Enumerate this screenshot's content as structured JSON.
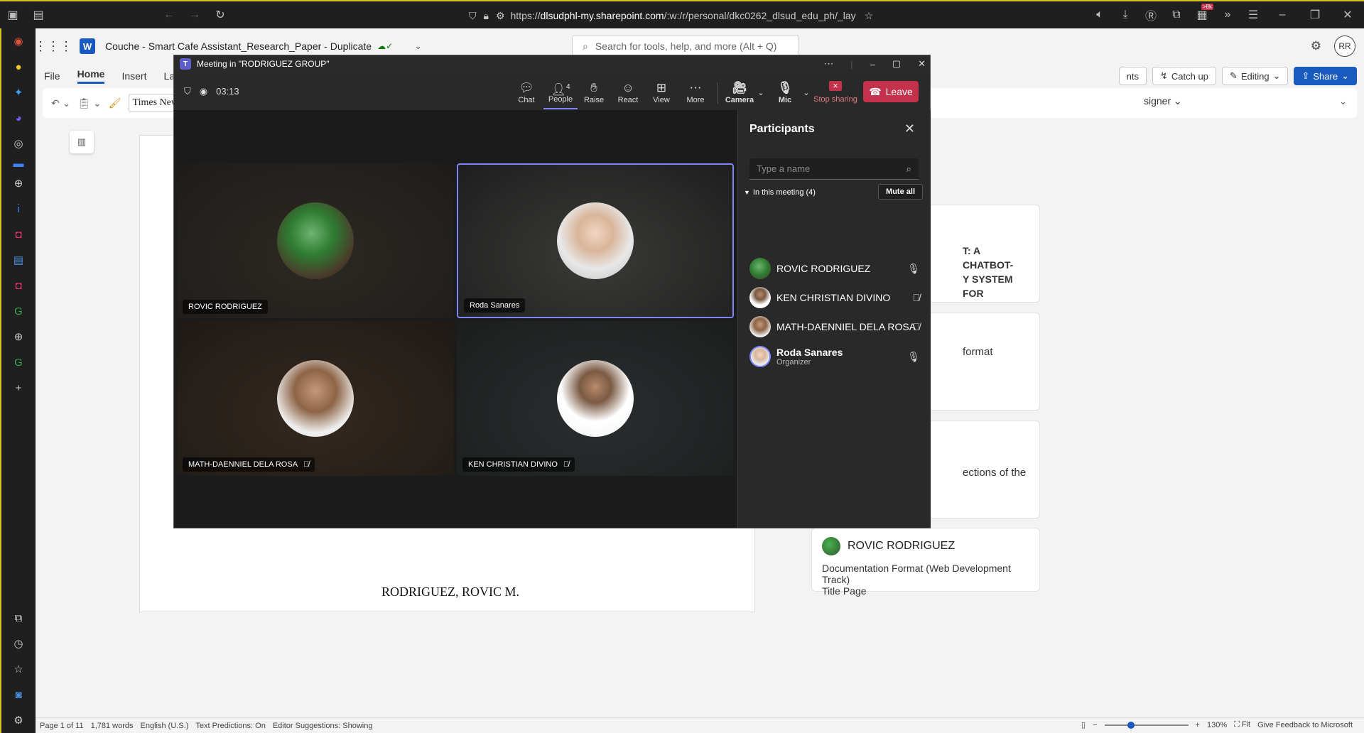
{
  "browser": {
    "url_prefix": "https://",
    "url_host": "dlsudphl-my.sharepoint.com",
    "url_path": "/:w:/r/personal/dkc0262_dlsud_edu_ph/_lay",
    "badge": ">8k"
  },
  "word": {
    "logo_letter": "W",
    "doc_title": "Couche - Smart Cafe Assistant_Research_Paper - Duplicate",
    "search_placeholder": "Search for tools, help, and more (Alt + Q)",
    "user_initials": "RR",
    "tabs": [
      "File",
      "Home",
      "Insert",
      "Layout"
    ],
    "ribbon_right": {
      "comments": "nts",
      "catch_up": "Catch up",
      "editing": "Editing",
      "share": "Share"
    },
    "font_name": "Times New Ro",
    "designer_label": "signer",
    "doc_author_line": "RODRIGUEZ, ROVIC M.",
    "cards": {
      "heading_line1": "T: A CHATBOT-",
      "heading_line2": "Y SYSTEM FOR",
      "format_text": "format",
      "sections_text": "ections of the",
      "comment_user": "ROVIC RODRIGUEZ",
      "comment_text_1": "Documentation Format (Web Development Track)",
      "comment_text_2": "Title Page"
    },
    "status": {
      "page": "Page 1 of 11",
      "words": "1,781 words",
      "language": "English (U.S.)",
      "predictions": "Text Predictions: On",
      "suggestions": "Editor Suggestions: Showing",
      "zoom": "130%",
      "fit": "Fit",
      "feedback": "Give Feedback to Microsoft",
      "zoom_level": 0.3
    }
  },
  "teams": {
    "window_title": "Meeting in \"RODRIGUEZ GROUP\"",
    "timer": "03:13",
    "controls": {
      "chat": "Chat",
      "people": "People",
      "people_count": "4",
      "raise": "Raise",
      "react": "React",
      "view": "View",
      "more": "More",
      "camera": "Camera",
      "mic": "Mic",
      "stop_sharing": "Stop sharing",
      "leave": "Leave"
    },
    "tiles": [
      {
        "name": "ROVIC RODRIGUEZ",
        "muted": false,
        "speaking": false
      },
      {
        "name": "Roda Sanares",
        "muted": false,
        "speaking": true
      },
      {
        "name": "MATH-DAENNIEL DELA ROSA",
        "muted": true,
        "speaking": false
      },
      {
        "name": "KEN CHRISTIAN DIVINO",
        "muted": true,
        "speaking": false
      }
    ],
    "participants": {
      "title": "Participants",
      "search_placeholder": "Type a name",
      "section_label": "In this meeting (4)",
      "mute_all": "Mute all",
      "list": [
        {
          "name": "ROVIC RODRIGUEZ",
          "role": "",
          "muted": false
        },
        {
          "name": "KEN CHRISTIAN DIVINO",
          "role": "",
          "muted": true
        },
        {
          "name": "MATH-DAENNIEL DELA ROSA",
          "role": "",
          "muted": true
        },
        {
          "name": "Roda Sanares",
          "role": "Organizer",
          "muted": false
        }
      ]
    }
  },
  "colors": {
    "accent_teams": "#7f85f5",
    "leave_red": "#c4314b",
    "word_blue": "#185abd"
  }
}
